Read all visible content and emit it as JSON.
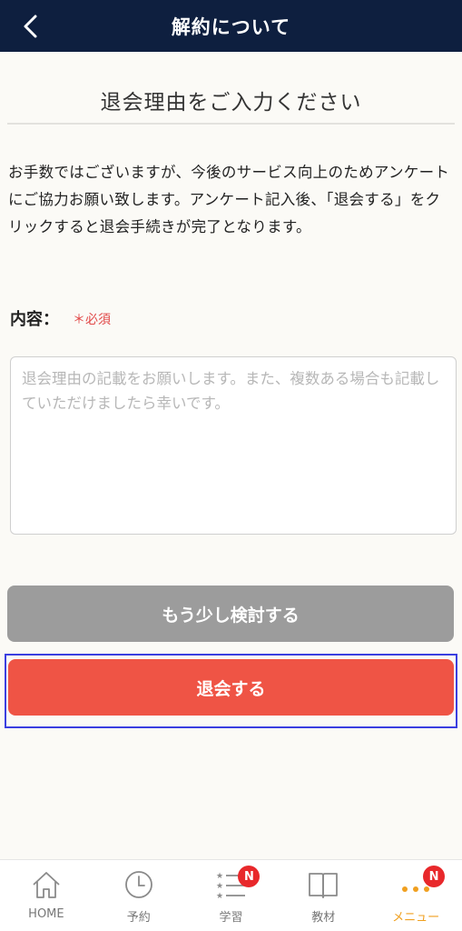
{
  "header": {
    "title": "解約について"
  },
  "section": {
    "title": "退会理由をご入力ください",
    "description": "お手数ではございますが、今後のサービス向上のためアンケートにご協力お願い致します。アンケート記入後、「退会する」をクリックすると退会手続きが完了となります。"
  },
  "form": {
    "label": "内容：",
    "required": "＊必須",
    "placeholder": "退会理由の記載をお願いします。また、複数ある場合も記載していただけましたら幸いです。",
    "value": ""
  },
  "buttons": {
    "reconsider": "もう少し検討する",
    "withdraw": "退会する"
  },
  "tabbar": {
    "items": [
      {
        "label": "HOME",
        "icon": "home-icon"
      },
      {
        "label": "予約",
        "icon": "clock-icon"
      },
      {
        "label": "学習",
        "icon": "list-icon",
        "badge": "N"
      },
      {
        "label": "教材",
        "icon": "book-icon"
      },
      {
        "label": "メニュー",
        "icon": "more-icon",
        "badge": "N",
        "active": true
      }
    ]
  },
  "colors": {
    "header_bg": "#0e1f3f",
    "withdraw_button": "#ef5445",
    "reconsider_button": "#9c9c9c",
    "active_tab": "#f0a020",
    "badge": "#e8282b",
    "required": "#e14848"
  }
}
